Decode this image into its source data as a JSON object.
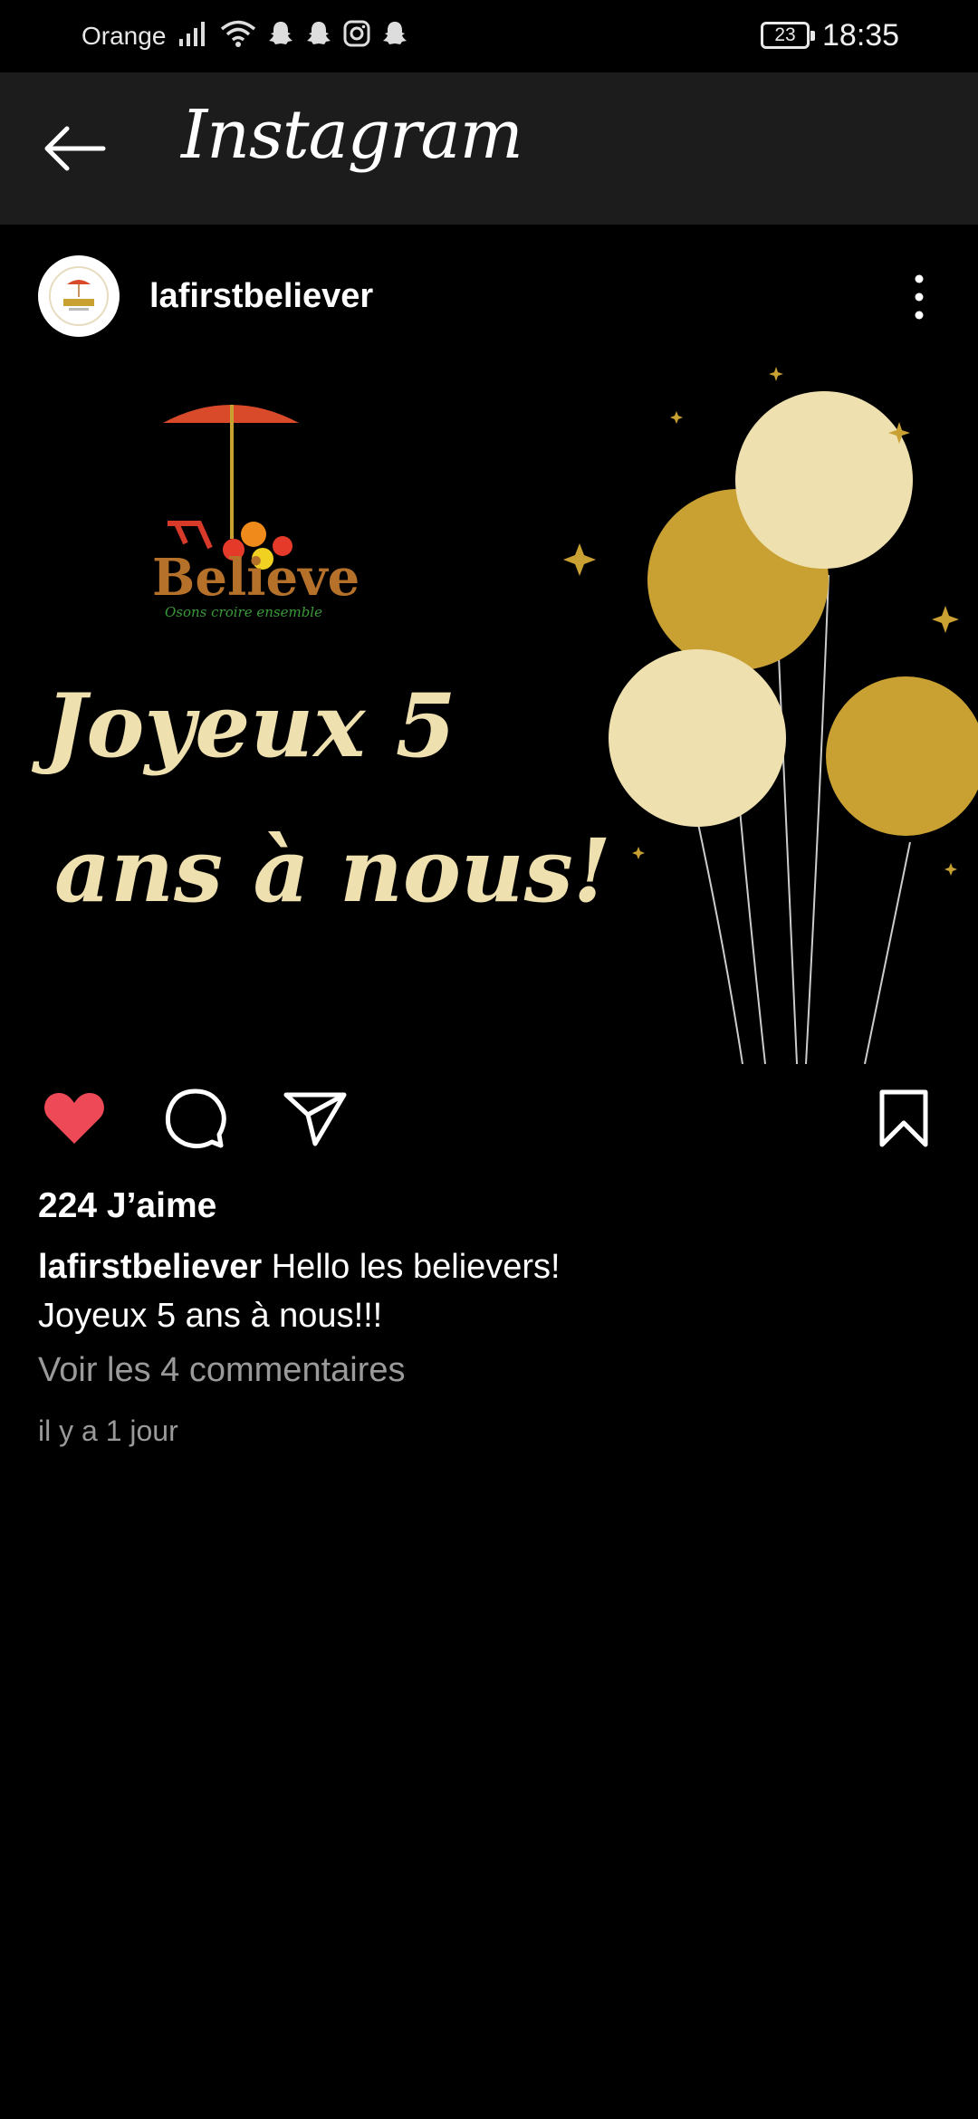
{
  "status_bar": {
    "carrier": "Orange",
    "icons": [
      "signal-icon",
      "wifi-icon",
      "snapchat-icon",
      "snapchat-icon",
      "instagram-icon",
      "snapchat-icon"
    ],
    "battery": "23",
    "time": "18:35"
  },
  "app_bar": {
    "back_icon": "back-arrow-icon",
    "title": "Instagram"
  },
  "post": {
    "username": "lafirstbeliever",
    "more_icon": "vertical-dots-icon",
    "image": {
      "logo_text": "Believe",
      "logo_tagline": "Osons croire ensemble",
      "greeting_line1": "Joyeux 5",
      "greeting_line2": "ans à nous!",
      "colors": {
        "cream": "#efe0b0",
        "gold": "#c9a032",
        "logo_brown": "#b5702a"
      }
    },
    "actions": {
      "like_icon": "heart-filled-icon",
      "comment_icon": "comment-bubble-icon",
      "share_icon": "paper-plane-icon",
      "save_icon": "bookmark-icon",
      "liked": true,
      "like_color": "#ed4956"
    },
    "likes": "224 J’aime",
    "caption_user": "lafirstbeliever",
    "caption_text": " Hello les believers!",
    "caption_line2": "Joyeux 5 ans à nous!!!",
    "comments_link": "Voir les 4 commentaires",
    "timestamp": "il y a 1 jour"
  }
}
